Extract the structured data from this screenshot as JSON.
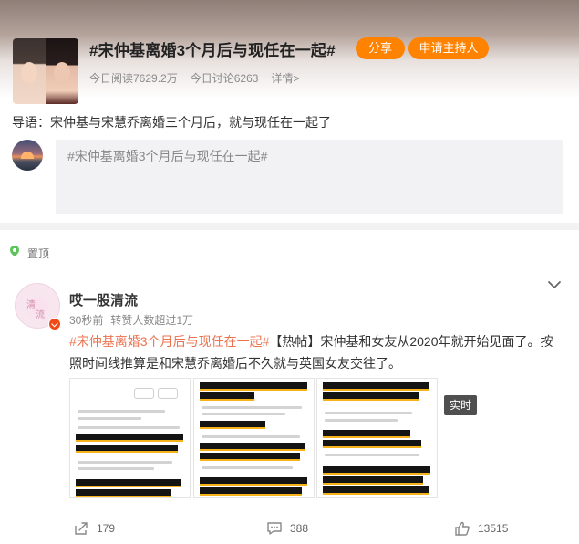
{
  "topic": {
    "title": "#宋仲基离婚3个月后与现任在一起#",
    "share_label": "分享",
    "apply_host_label": "申请主持人",
    "read_count": "今日阅读7629.2万",
    "discuss_count": "今日讨论6263",
    "details_label": "详情>"
  },
  "intro": "导语：宋仲基与宋慧乔离婚三个月后，就与现任在一起了",
  "composer": {
    "default_text": "#宋仲基离婚3个月后与现任在一起#"
  },
  "pinned_label": "置顶",
  "post": {
    "author": "哎一股清流",
    "avatar_text": [
      "清",
      "流"
    ],
    "time": "30秒前",
    "reposts_meta": "转赞人数超过1万",
    "hashtag": "#宋仲基离婚3个月后与现任在一起#",
    "text_rest": "【热帖】宋仲基和女友从2020年就开始见面了。按照时间线推算是和宋慧乔离婚后不久就与英国女友交往了。",
    "live_badge": "实时",
    "repost_count": "179",
    "comment_count": "388",
    "like_count": "13515"
  },
  "colors": {
    "accent_orange": "#ff8200",
    "hashtag": "#eb7350",
    "vip_badge": "#f04b16"
  },
  "icons": [
    "share-arrow-icon",
    "comment-icon",
    "like-icon",
    "chevron-down-icon",
    "pin-icon"
  ]
}
